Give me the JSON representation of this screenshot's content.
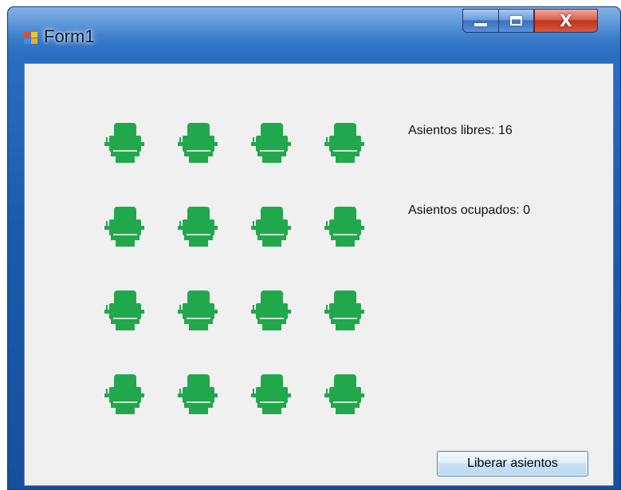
{
  "window": {
    "title": "Form1",
    "icon": "winforms-app-icon",
    "controls": {
      "minimize_icon": "minimize-icon",
      "maximize_icon": "maximize-icon",
      "close_glyph": "X"
    }
  },
  "seats": {
    "rows": 4,
    "columns": 4,
    "state": "free",
    "color": "#22a84c",
    "icon": "seat-icon"
  },
  "info": {
    "free_label": "Asientos libres: 16",
    "occupied_label": "Asientos ocupados: 0"
  },
  "actions": {
    "release_button": "Liberar asientos"
  }
}
